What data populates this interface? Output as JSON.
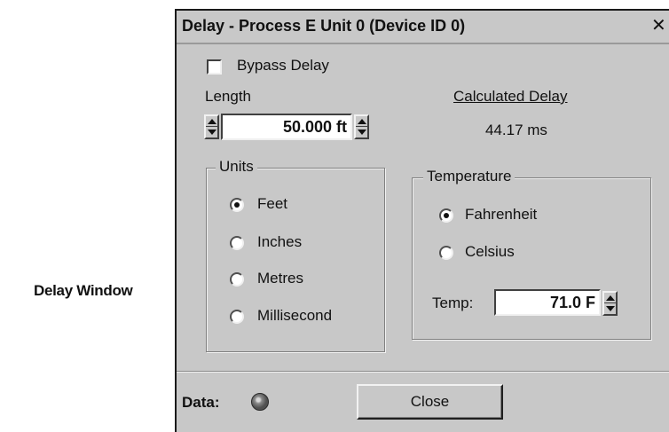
{
  "caption": "Delay Window",
  "dialog": {
    "title": "Delay - Process E  Unit 0 (Device ID 0)",
    "close_glyph": "✕"
  },
  "bypass": {
    "label": "Bypass Delay",
    "checked": false
  },
  "length": {
    "label": "Length",
    "value": "50.000 ft"
  },
  "calculated": {
    "label": "Calculated Delay",
    "value": "44.17 ms"
  },
  "units": {
    "title": "Units",
    "options": [
      {
        "label": "Feet",
        "selected": true
      },
      {
        "label": "Inches",
        "selected": false
      },
      {
        "label": "Metres",
        "selected": false
      },
      {
        "label": "Millisecond",
        "selected": false
      }
    ]
  },
  "temperature": {
    "title": "Temperature",
    "options": [
      {
        "label": "Fahrenheit",
        "selected": true
      },
      {
        "label": "Celsius",
        "selected": false
      }
    ],
    "temp_label": "Temp:",
    "temp_value": "71.0 F"
  },
  "footer": {
    "data_label": "Data:",
    "close_button": "Close"
  }
}
